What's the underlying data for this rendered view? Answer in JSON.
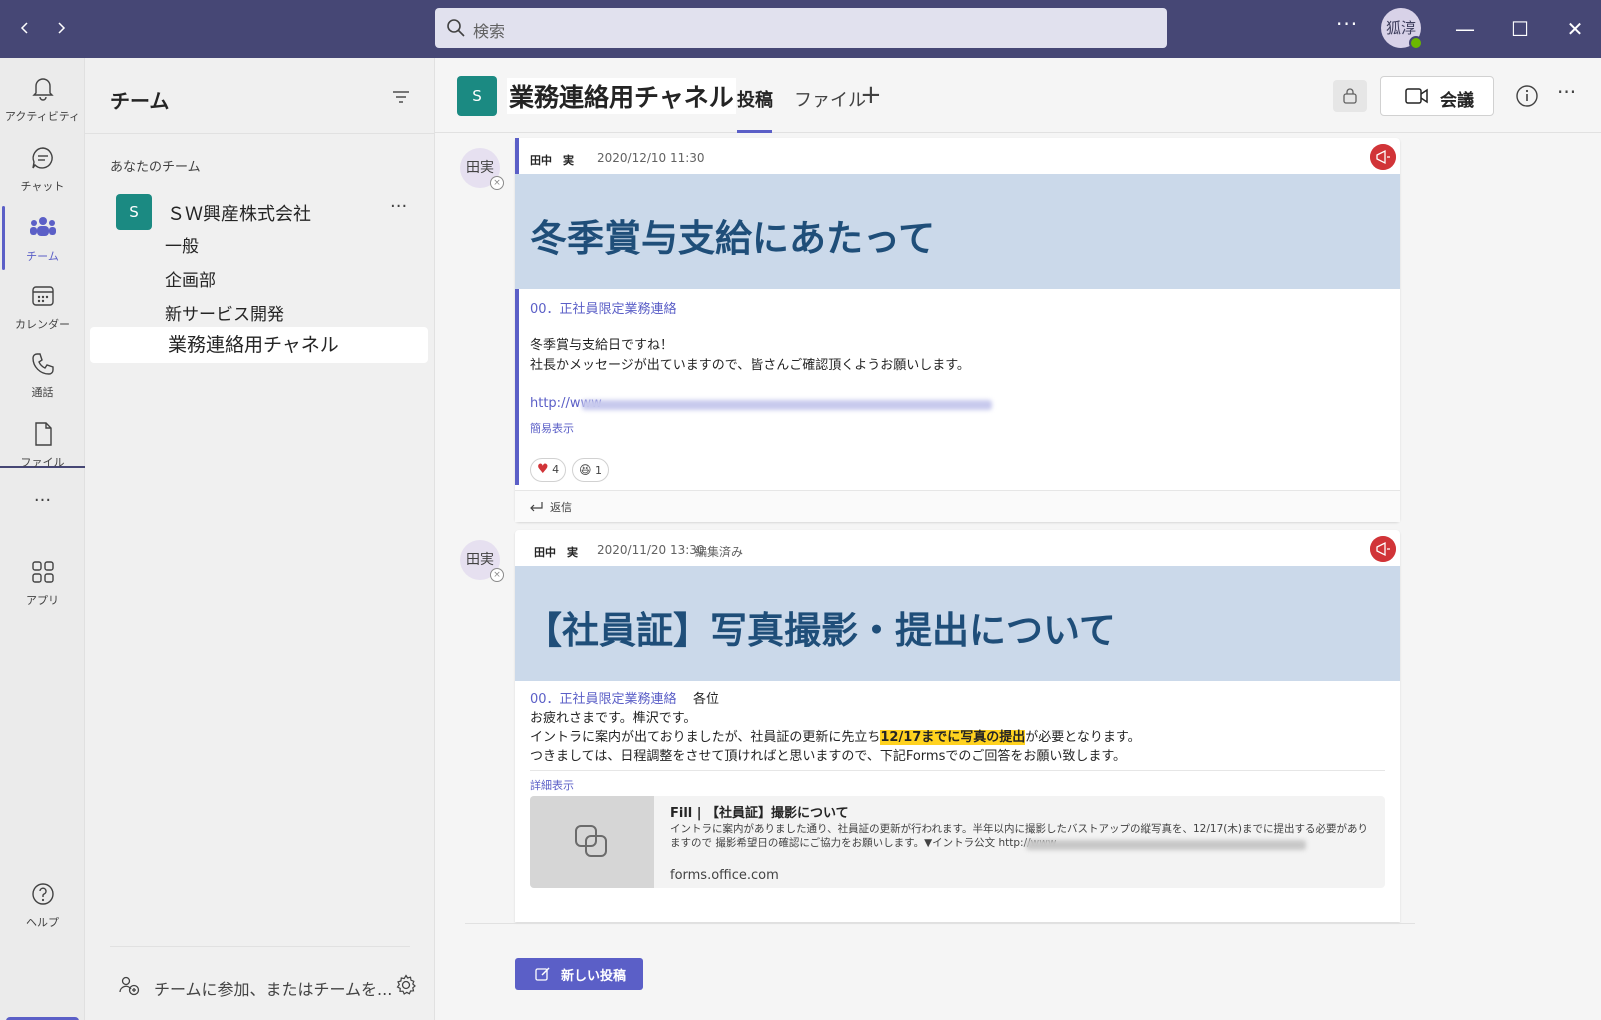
{
  "titlebar": {
    "back_icon": "chevron-left-icon",
    "forward_icon": "chevron-right-icon",
    "search_placeholder": "検索",
    "more": "···",
    "user_avatar": "狐淳",
    "minimize": "—",
    "maximize": "☐",
    "close": "✕"
  },
  "rail": {
    "items": [
      {
        "label": "アクティビティ",
        "icon": "bell-icon"
      },
      {
        "label": "チャット",
        "icon": "chat-icon"
      },
      {
        "label": "チーム",
        "icon": "teams-icon"
      },
      {
        "label": "カレンダー",
        "icon": "calendar-icon"
      },
      {
        "label": "通話",
        "icon": "phone-icon"
      },
      {
        "label": "ファイル",
        "icon": "file-icon"
      },
      {
        "label": "···",
        "icon": "more-icon"
      },
      {
        "label": "アプリ",
        "icon": "apps-icon"
      },
      {
        "label": "ヘルプ",
        "icon": "help-icon"
      }
    ],
    "mobile_icon": "mobile-icon"
  },
  "teams_panel": {
    "title": "チーム",
    "section": "あなたのチーム",
    "team": {
      "badge": "S",
      "name": "ＳＷ興産株式会社",
      "more": "···"
    },
    "channels": [
      "一般",
      "企画部",
      "新サービス開発",
      "業務連絡用チャネル"
    ],
    "join_text": "チームに参加、またはチームを..."
  },
  "channel_header": {
    "badge": "S",
    "title": "業務連絡用チャネル",
    "tabs": [
      "投稿",
      "ファイル"
    ],
    "add_tab": "+",
    "meet_label": "会議",
    "more": "···"
  },
  "posts": [
    {
      "avatar": "田実",
      "author": "田中　実",
      "time": "2020/12/10 11:30",
      "banner": "冬季賞与支給にあたって",
      "tag": "00．正社員限定業務連絡",
      "lines": [
        "冬季賞与支給日ですね！",
        "社長かメッセージが出ていますので、皆さんご確認頂くようお願いします。"
      ],
      "link_prefix": "http://www",
      "toggle": "簡易表示",
      "reactions": [
        {
          "emoji": "♥",
          "count": "4"
        },
        {
          "emoji": "😆",
          "count": "1"
        }
      ],
      "reply": "返信"
    },
    {
      "avatar": "田実",
      "author": "田中　実",
      "time": "2020/11/20 13:30",
      "edited": "編集済み",
      "banner": "【社員証】写真撮影・提出について",
      "tag": "00．正社員限定業務連絡",
      "greeting": "各位",
      "line1": "お疲れさまです。榫沢です。",
      "line2_pre": "イントラに案内が出ておりましたが、社員証の更新に先立ち",
      "line2_hl": "12/17までに写真の提出",
      "line2_post": "が必要となります。",
      "line3": "つきましては、日程調整をさせて頂ければと思いますので、下記Formsでのご回答をお願い致します。",
      "toggle": "詳細表示",
      "card": {
        "title": "Fill | 【社員証】撮影について",
        "desc": "イントラに案内がありました通り、社員証の更新が行われます。半年以内に撮影したバストアップの縦写真を、12/17(木)までに提出する必要がありますので 撮影希望日の確認にご協力をお願いします。▼イントラ公文 http://www",
        "domain": "forms.office.com"
      }
    }
  ],
  "new_post_label": "新しい投稿",
  "colors": {
    "titlebar": "#464775",
    "accent": "#5b5fc7",
    "team_badge": "#1b8a82",
    "banner": "#cbd9ea",
    "banner_text": "#1f4e79",
    "highlight": "#ffd21f"
  }
}
